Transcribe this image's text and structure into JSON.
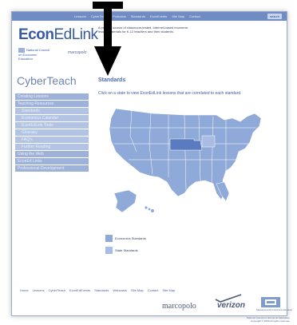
{
  "topnav": {
    "items": [
      "Lessons",
      "CyberTeach",
      "Podcasts",
      "Standards",
      "EconEvents",
      "Site Map",
      "Contact"
    ],
    "search_label": "search"
  },
  "brand": {
    "logo_bold": "Econ",
    "logo_light": "EdLink",
    "partner_text": "National Council on Economic Education",
    "marcopolo": "marcopolo",
    "tagline": "A premier source of classroom-tested, Internet-based economic lesson materials for K-12 teachers and their students."
  },
  "cyberteach_title": "CyberTeach",
  "sidebar": {
    "items": [
      {
        "label": "Creating Lessons",
        "sub": false
      },
      {
        "label": "Teaching Resources",
        "sub": false
      },
      {
        "label": "Standards",
        "sub": true
      },
      {
        "label": "Economics Calendar",
        "sub": true
      },
      {
        "label": "EconEdLink Tools",
        "sub": true
      },
      {
        "label": "Glossary",
        "sub": true
      },
      {
        "label": "FAQ's",
        "sub": true
      },
      {
        "label": "Further Reading",
        "sub": true
      },
      {
        "label": "Using the Web",
        "sub": false
      },
      {
        "label": "EconEd Links",
        "sub": false
      },
      {
        "label": "Professional Development",
        "sub": false
      }
    ]
  },
  "main": {
    "title": "Standards",
    "instruction": "Click on a state to view EconEdLink lessons that are correlated to each standard."
  },
  "legend": {
    "items": [
      {
        "label": "Economics Standards",
        "color": "#8faad9"
      },
      {
        "label": "State Standards",
        "color": "#a9bde4"
      }
    ]
  },
  "footer": {
    "links": [
      "Home",
      "Lessons",
      "CyberTeach",
      "EconEdEvents",
      "Standards",
      "Webcasts",
      "Site Map",
      "Contact",
      "Site Map"
    ],
    "marcopolo": "marcopolo",
    "verizon": "verizon",
    "ncee_label": "National Council on Economic Education",
    "copyright_line1": "National Council on Economic Education",
    "copyright_line2": "Copyright © 2006 All rights reserved."
  },
  "colors": {
    "nav_bar": "#6f8cc3",
    "map_fill": "#8faad9",
    "map_highlight": "#5a7bbf",
    "brand_blue": "#365aa3"
  },
  "overlay_icon": "down-arrow-icon"
}
